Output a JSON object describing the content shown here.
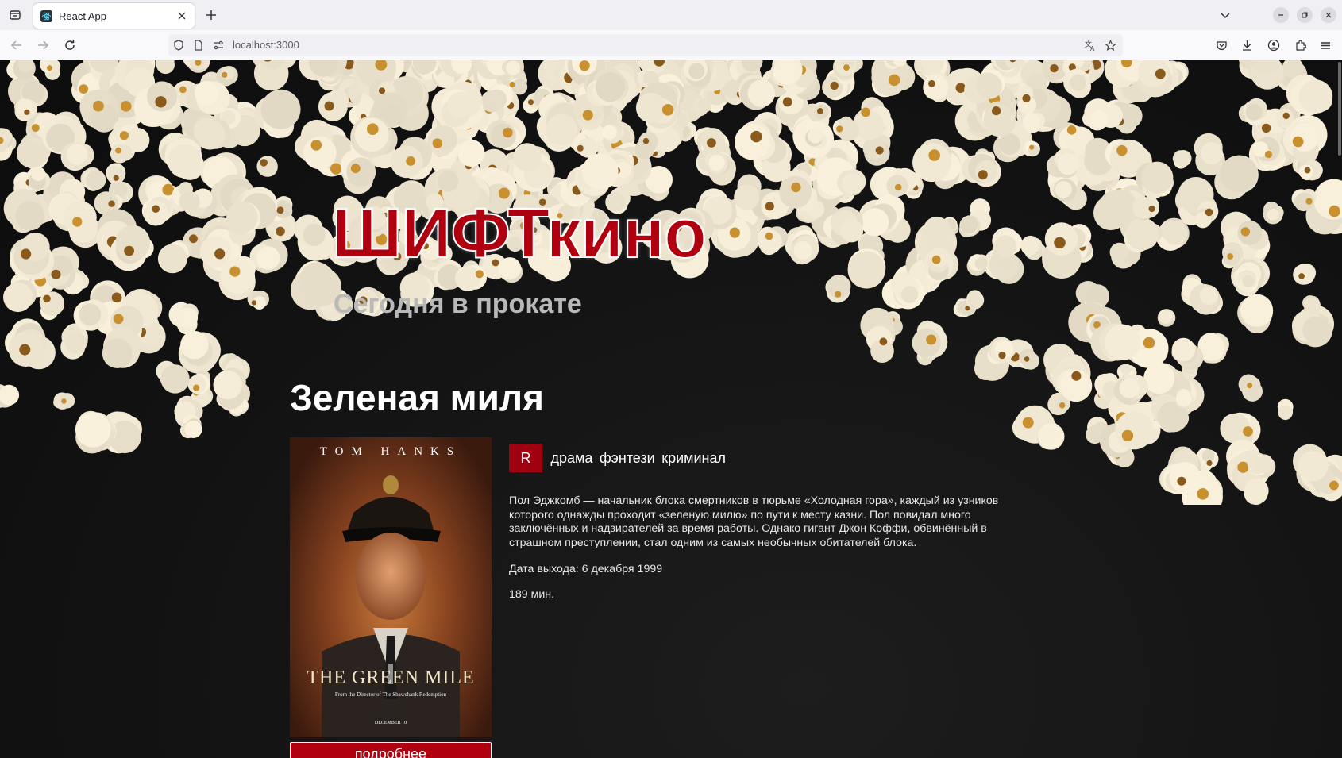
{
  "browser": {
    "tab_title": "React App",
    "url": "localhost:3000"
  },
  "site": {
    "logo": "ШИФТкино",
    "subtitle": "Сегодня в прокате"
  },
  "movie": {
    "title": "Зеленая миля",
    "rating": "R",
    "genres": [
      "драма",
      "фэнтези",
      "криминал"
    ],
    "description": "Пол Эджкомб — начальник блока смертников в тюрьме «Холодная гора», каждый из узников которого однажды проходит «зеленую милю» по пути к месту казни. Пол повидал много заключённых и надзирателей за время работы. Однако гигант Джон Коффи, обвинённый в страшном преступлении, стал одним из самых необычных обитателей блока.",
    "release": "Дата выхода: 6 декабря 1999",
    "duration": "189 мин.",
    "details_button": "подробнее",
    "poster": {
      "actor": "TOM HANKS",
      "movie_name": "THE GREEN MILE",
      "tagline": "From the Director of The Shawshank Redemption",
      "date": "DECEMBER 10"
    }
  },
  "colors": {
    "brand_red": "#b00010",
    "background": "#111111"
  }
}
